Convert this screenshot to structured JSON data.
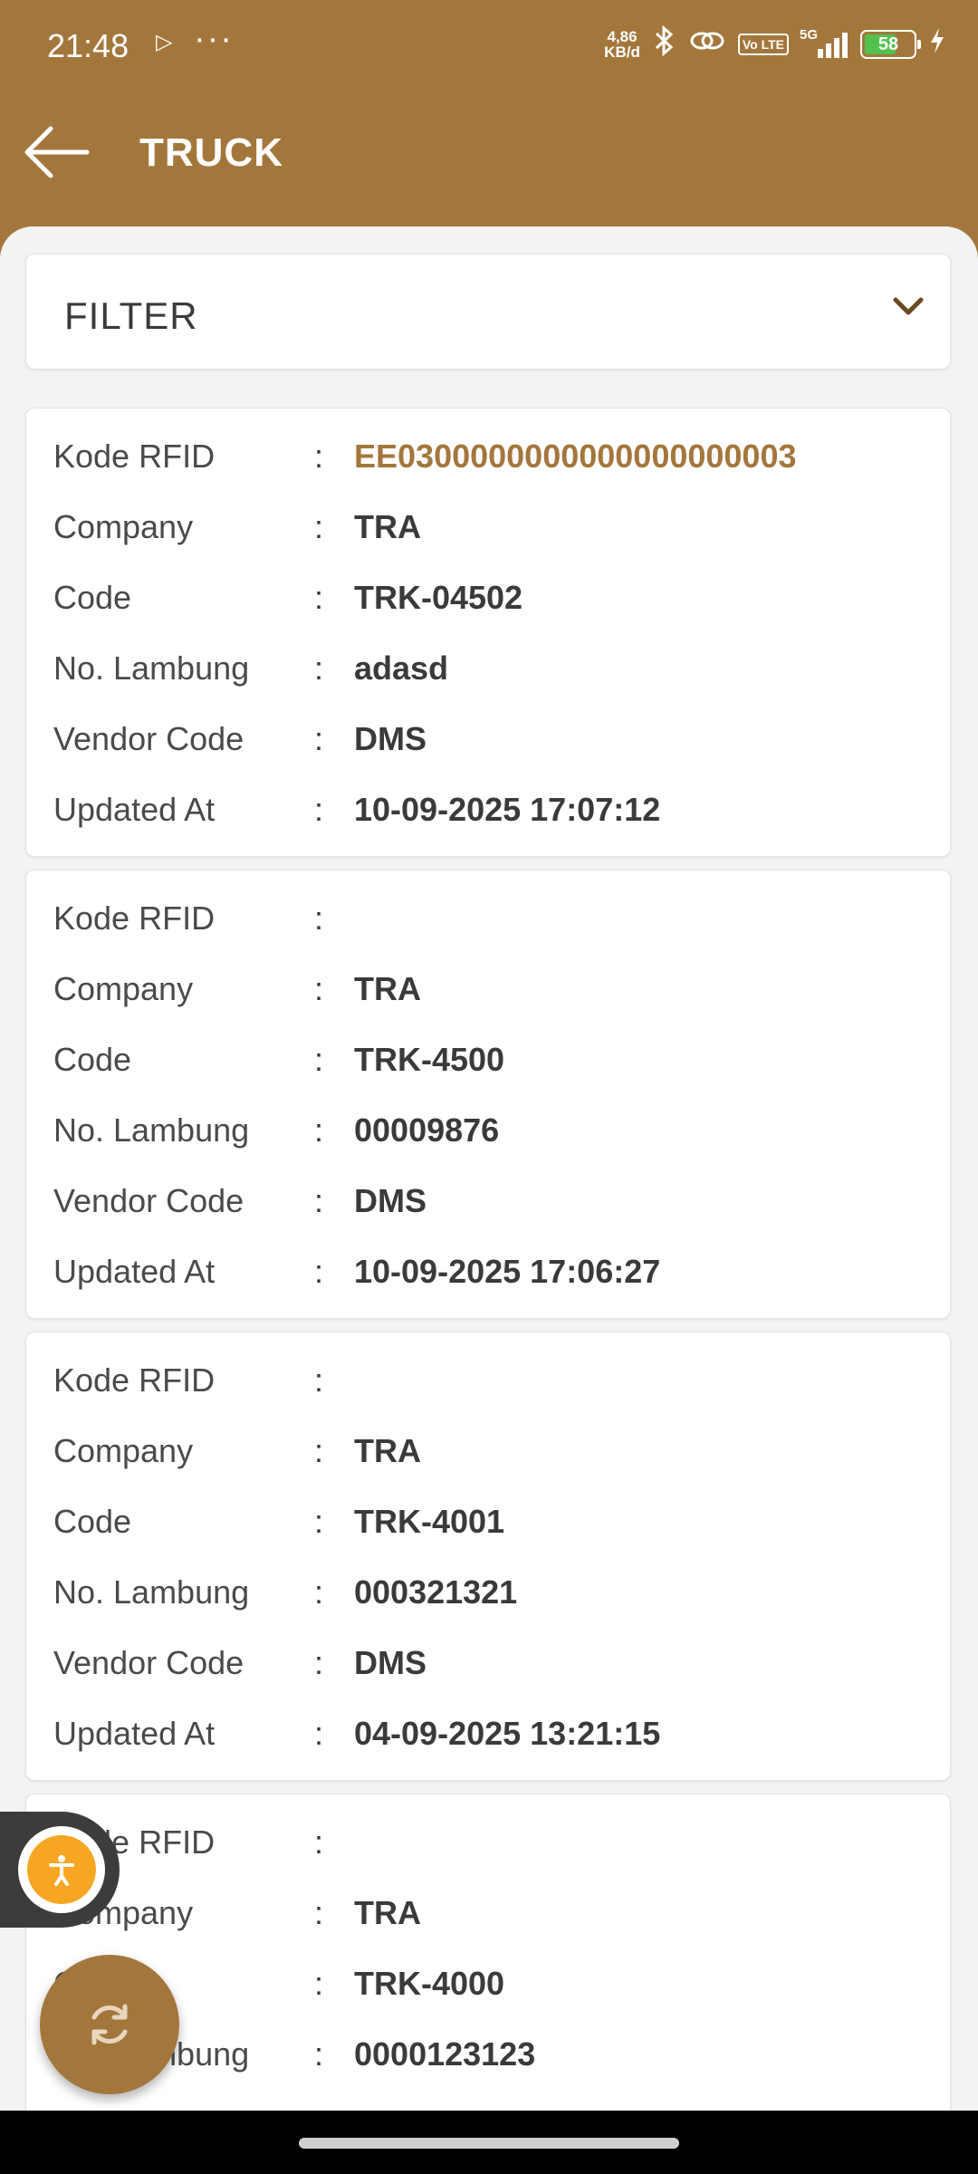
{
  "status_bar": {
    "time": "21:48",
    "speed_value": "4,86",
    "speed_unit": "KB/d",
    "network": "5G",
    "volte": "Vo LTE",
    "battery": "58"
  },
  "header": {
    "title": "TRUCK"
  },
  "filter": {
    "label": "FILTER"
  },
  "labels": {
    "rfid": "Kode RFID",
    "company": "Company",
    "code": "Code",
    "lambung": "No. Lambung",
    "vendor": "Vendor Code",
    "updated": "Updated At",
    "sep": ":"
  },
  "trucks": [
    {
      "rfid": "EE0300000000000000000003",
      "company": "TRA",
      "code": "TRK-04502",
      "lambung": "adasd",
      "vendor": "DMS",
      "updated": "10-09-2025 17:07:12"
    },
    {
      "rfid": "",
      "company": "TRA",
      "code": "TRK-4500",
      "lambung": "00009876",
      "vendor": "DMS",
      "updated": "10-09-2025 17:06:27"
    },
    {
      "rfid": "",
      "company": "TRA",
      "code": "TRK-4001",
      "lambung": "000321321",
      "vendor": "DMS",
      "updated": "04-09-2025 13:21:15"
    },
    {
      "rfid": "",
      "company": "TRA",
      "code": "TRK-4000",
      "lambung": "0000123123"
    }
  ],
  "colors": {
    "accent": "#a3773c",
    "background": "#f3f3f3",
    "fab_accessibility": "#f7a623"
  },
  "icons": {
    "back": "arrow-left-icon",
    "filter": "chevron-down-icon",
    "accessibility": "accessibility-icon",
    "refresh": "refresh-icon"
  }
}
